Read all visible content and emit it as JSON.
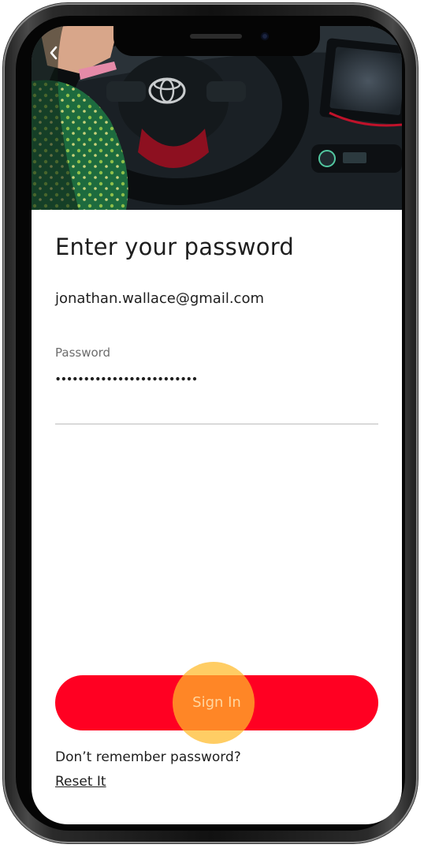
{
  "header": {
    "back_icon": "chevron-left-icon",
    "hero_image": "car-interior-photo",
    "logo": "toyota-logo"
  },
  "main": {
    "title": "Enter your password",
    "email": "jonathan.wallace@gmail.com",
    "password_field": {
      "label": "Password",
      "value": "•••••••••••••••••••••••••"
    },
    "sign_in_label": "Sign In",
    "forgot_text": "Don’t remember password?",
    "reset_link": "Reset It"
  },
  "colors": {
    "accent": "#ff0022",
    "tap_highlight": "#ffba28",
    "text": "#1e1e1e",
    "label_gray": "#6d6d6d"
  }
}
